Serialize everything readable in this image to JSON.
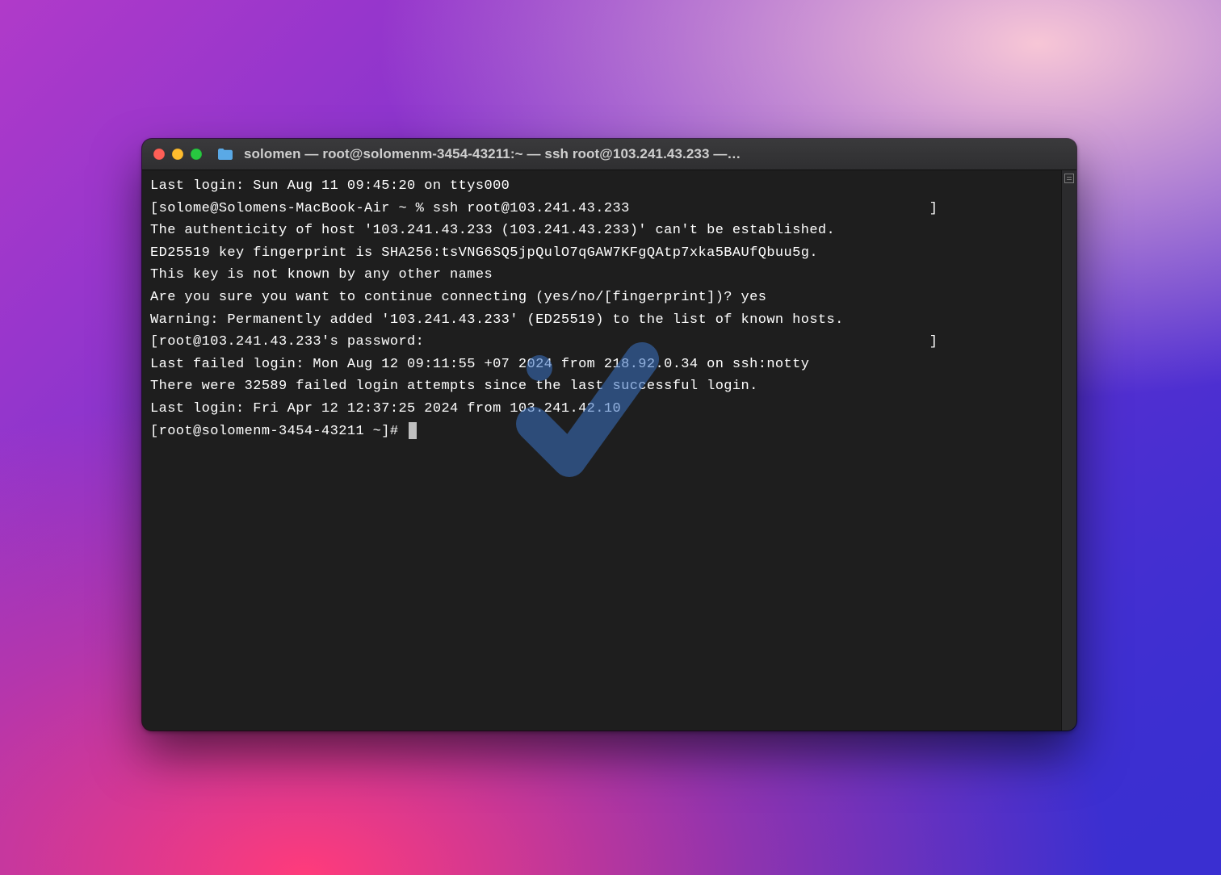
{
  "window": {
    "title": "solomen — root@solomenm-3454-43211:~ — ssh root@103.241.43.233 —…"
  },
  "terminal": {
    "lines": [
      "Last login: Sun Aug 11 09:45:20 on ttys000",
      "[solome@Solomens-MacBook-Air ~ % ssh root@103.241.43.233                                   ]",
      "The authenticity of host '103.241.43.233 (103.241.43.233)' can't be established.",
      "ED25519 key fingerprint is SHA256:tsVNG6SQ5jpQulO7qGAW7KFgQAtp7xka5BAUfQbuu5g.",
      "This key is not known by any other names",
      "Are you sure you want to continue connecting (yes/no/[fingerprint])? yes",
      "Warning: Permanently added '103.241.43.233' (ED25519) to the list of known hosts.",
      "[root@103.241.43.233's password:                                                           ]",
      "Last failed login: Mon Aug 12 09:11:55 +07 2024 from 218.92.0.34 on ssh:notty",
      "There were 32589 failed login attempts since the last successful login.",
      "Last login: Fri Apr 12 12:37:25 2024 from 103.241.42.10"
    ],
    "prompt": "[root@solomenm-3454-43211 ~]# "
  },
  "colors": {
    "terminal_bg": "#1e1e1e",
    "terminal_fg": "#ffffff",
    "close": "#ff5f57",
    "minimize": "#febc2e",
    "zoom": "#28c840",
    "watermark": "#3a72c4"
  }
}
